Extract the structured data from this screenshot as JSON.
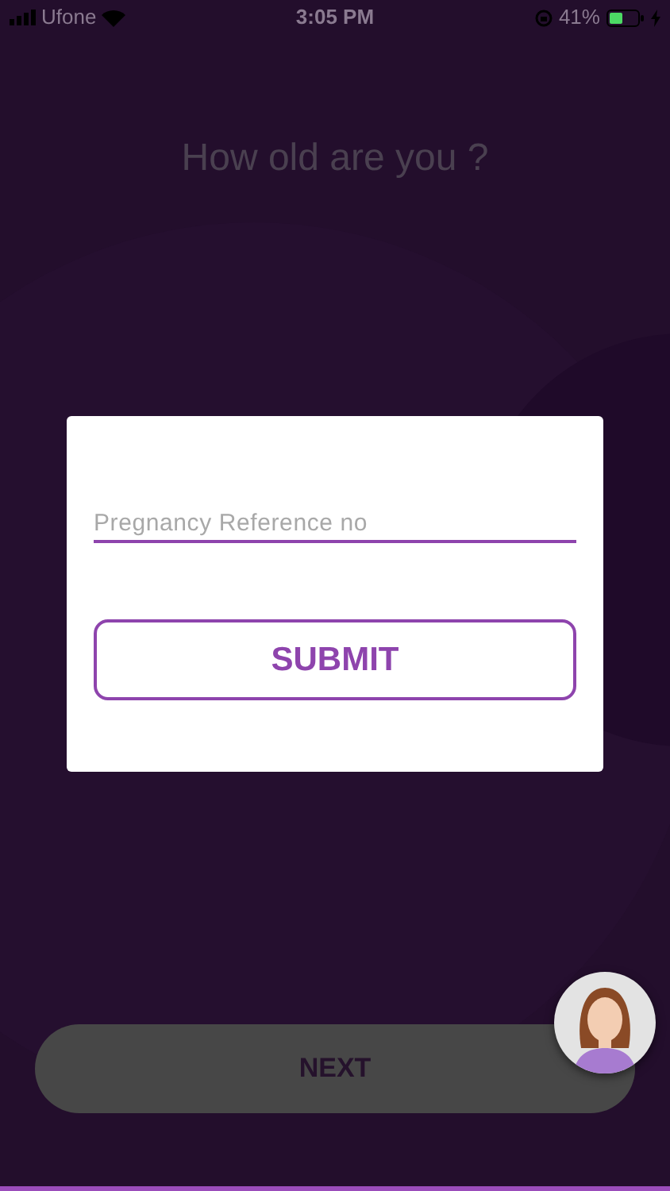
{
  "status_bar": {
    "carrier": "Ufone",
    "time": "3:05 PM",
    "battery": "41%"
  },
  "question": "How old are you ?",
  "next_button": {
    "label": "NEXT",
    "disabled": true
  },
  "dialog": {
    "field": {
      "placeholder": "Pregnancy Reference no"
    },
    "submit_button": {
      "label": "SUBMIT"
    }
  }
}
